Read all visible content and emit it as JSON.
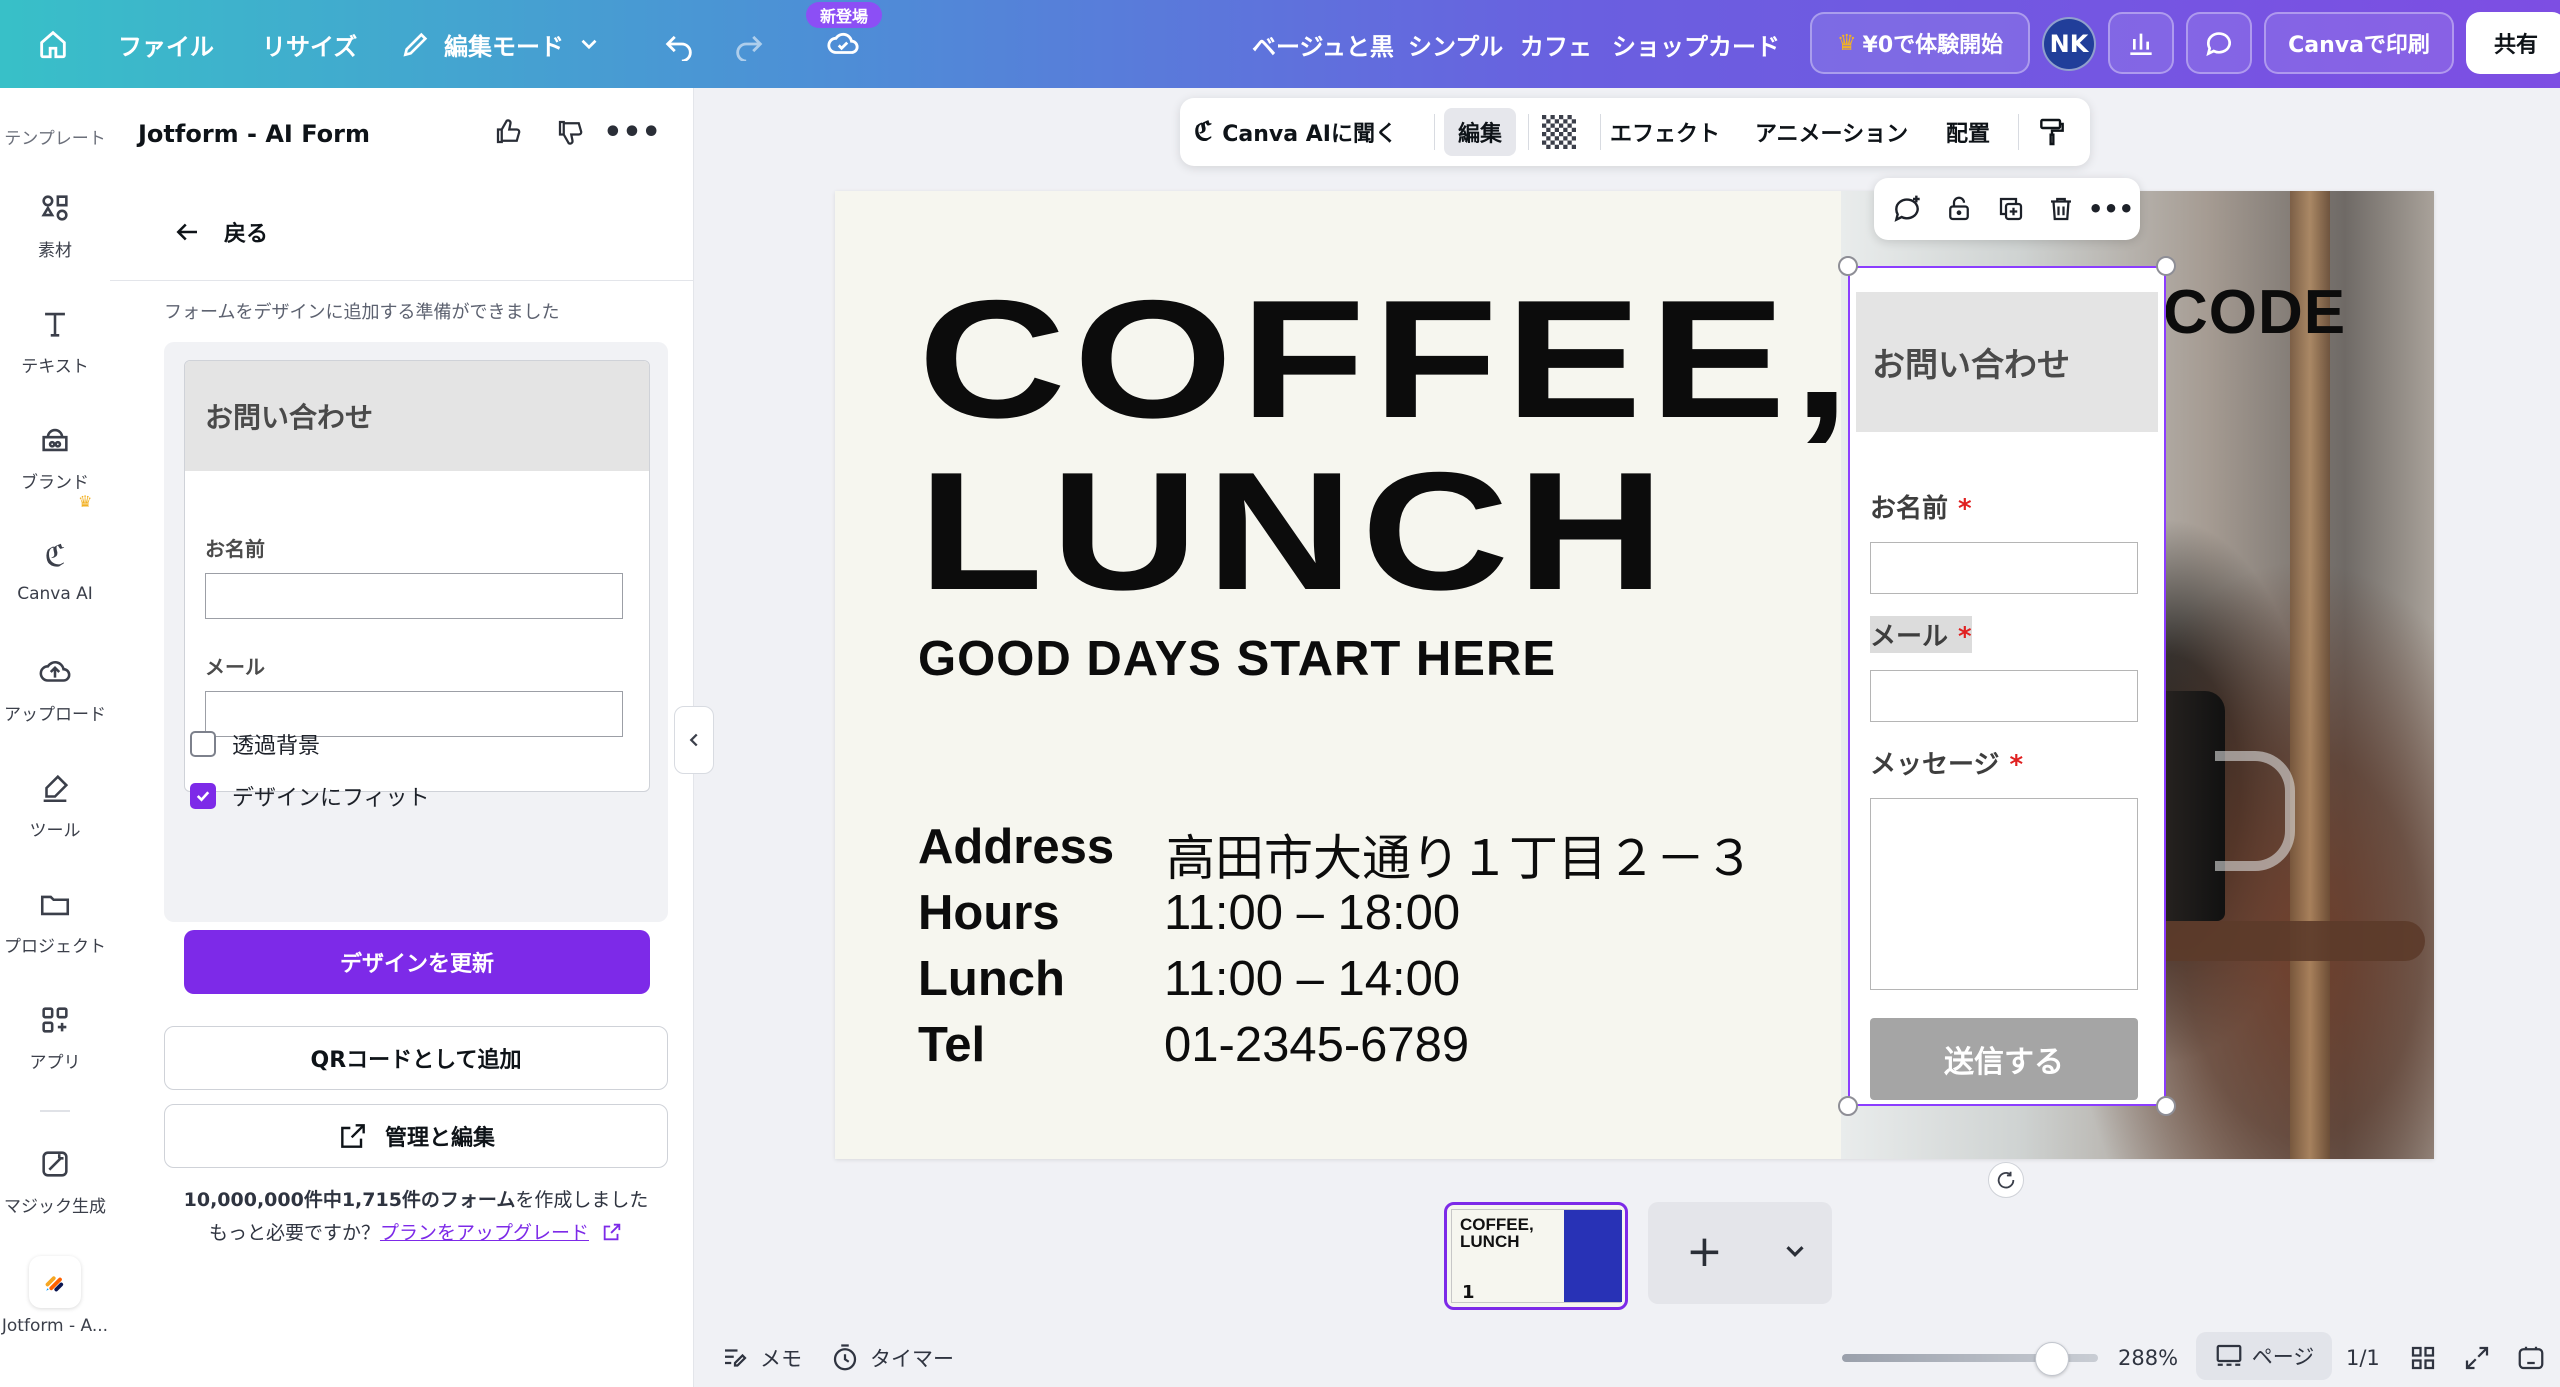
{
  "topbar": {
    "menu": [
      "ファイル",
      "リサイズ",
      "編集モード"
    ],
    "new_badge": "新登場",
    "suggestions": [
      "ベージュと黒",
      "シンプル",
      "カフェ",
      "ショップカード"
    ],
    "trial_button": "¥0で体験開始",
    "avatar": "NK",
    "print_button": "Canvaで印刷",
    "share_button": "共有",
    "colors": {
      "gradient_start": "#38c0c8",
      "gradient_end": "#7d4ee3"
    }
  },
  "rail": {
    "items": [
      {
        "label": "テンプレート",
        "icon": "template-icon"
      },
      {
        "label": "素材",
        "icon": "elements-icon"
      },
      {
        "label": "テキスト",
        "icon": "text-icon"
      },
      {
        "label": "ブランド",
        "icon": "brand-icon"
      },
      {
        "label": "Canva AI",
        "icon": "canva-ai-icon"
      },
      {
        "label": "アップロード",
        "icon": "upload-icon"
      },
      {
        "label": "ツール",
        "icon": "tools-icon"
      },
      {
        "label": "プロジェクト",
        "icon": "folder-icon"
      },
      {
        "label": "アプリ",
        "icon": "apps-icon"
      },
      {
        "label": "マジック生成",
        "icon": "magic-icon"
      },
      {
        "label": "Jotform - A...",
        "icon": "jotform-icon"
      }
    ]
  },
  "panel": {
    "title": "Jotform - AI Form",
    "back": "戻る",
    "ready_text": "フォームをデザインに追加する準備ができました",
    "preview": {
      "header": "お問い合わせ",
      "labels": [
        "お名前",
        "メール"
      ]
    },
    "checkboxes": [
      {
        "label": "透過背景",
        "checked": false
      },
      {
        "label": "デザインにフィット",
        "checked": true
      }
    ],
    "update_button": "デザインを更新",
    "qr_button": "QRコードとして追加",
    "manage_button": "管理と編集",
    "quota_count": "10,000,000件中1,715件のフォーム",
    "quota_suffix": "を作成しました",
    "quota_question": "もっと必要ですか？",
    "upgrade_link": "プランをアップグレード",
    "accent": "#7d2ae8"
  },
  "editor_toolbar": {
    "ask_ai": "Canva AIに聞く",
    "edit": "編集",
    "effects": "エフェクト",
    "animation": "アニメーション",
    "arrange": "配置"
  },
  "design": {
    "title_line1": "COFFEE,",
    "title_line2": "LUNCH",
    "tagline": "GOOD DAYS START HERE",
    "qr_text": "CODE",
    "info": [
      {
        "key": "Address",
        "value": "高田市大通り１丁目２－３"
      },
      {
        "key": "Hours",
        "value": "11:00 – 18:00"
      },
      {
        "key": "Lunch",
        "value": "11:00 – 14:00"
      },
      {
        "key": "Tel",
        "value": "01-2345-6789"
      }
    ],
    "form": {
      "header": "お問い合わせ",
      "fields": [
        "お名前",
        "メール",
        "メッセージ"
      ],
      "required_mark": "*",
      "submit": "送信する"
    }
  },
  "pages": {
    "thumb_title": "COFFEE,\nLUNCH",
    "thumb_number": "1"
  },
  "bottombar": {
    "notes": "メモ",
    "timer": "タイマー",
    "zoom": "288%",
    "zoom_level": 0.82,
    "page_view": "ページ",
    "page_count": "1/1"
  }
}
